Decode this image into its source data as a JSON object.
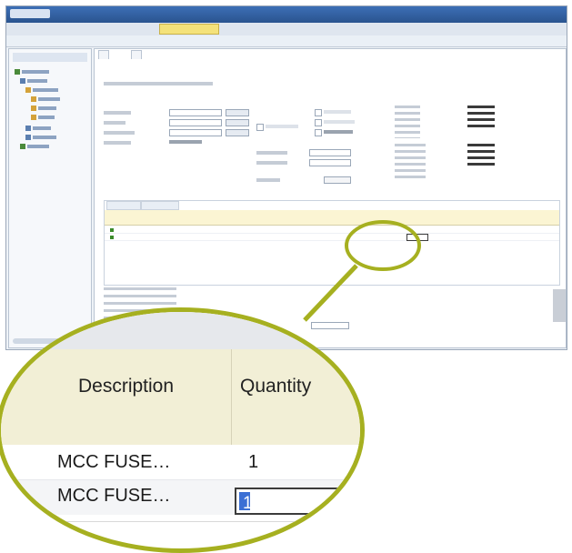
{
  "colors": {
    "callout_ring": "#a6b020",
    "header_band": "#f2efd6",
    "selection": "#3b6fd4",
    "titlebar": "#2a548f",
    "menu_highlight": "#f4e27a"
  },
  "zoom": {
    "columns": {
      "description": "Description",
      "quantity": "Quantity"
    },
    "rows": [
      {
        "description": "MCC FUSE…",
        "quantity": "1"
      },
      {
        "description": "MCC FUSE…",
        "quantity": "1"
      }
    ]
  },
  "icons": [
    "tree-node-icon",
    "grid-row-status-icon"
  ]
}
